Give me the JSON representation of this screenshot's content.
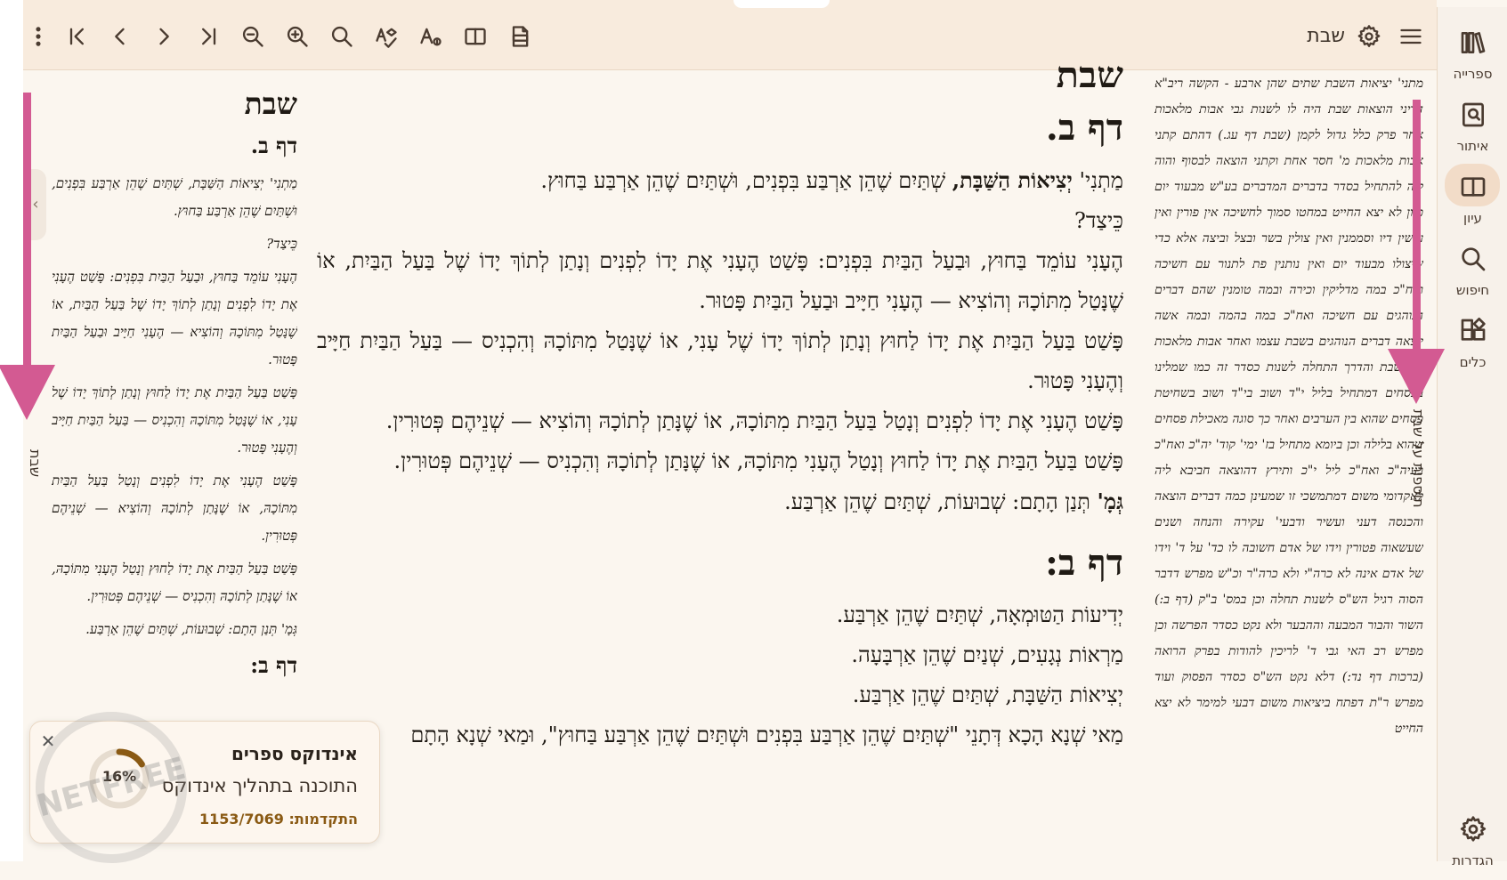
{
  "book_title": "שבת",
  "toolbar": {
    "buttons": [
      "more",
      "first-page",
      "previous",
      "next",
      "last-page",
      "zoom-out",
      "zoom-in",
      "search",
      "spell",
      "font",
      "columns",
      "pdf"
    ]
  },
  "right_nav": {
    "items": [
      {
        "icon": "library-icon",
        "label": "ספרייה"
      },
      {
        "icon": "locate-icon",
        "label": "איתור"
      },
      {
        "icon": "reading-icon",
        "label": "עיון"
      },
      {
        "icon": "search-icon",
        "label": "חיפוש"
      },
      {
        "icon": "tools-icon",
        "label": "כלים"
      }
    ],
    "settings": {
      "icon": "gear-icon",
      "label": "הגדרות"
    }
  },
  "main": {
    "title": "שבת",
    "daf1": "דף ב.",
    "mishnah_prefix": "מַתְנִי'",
    "mishnah_bold": "יְצִיאוֹת הַשַּׁבָּת,",
    "mishnah_rest": "שְׁתַּיִם שֶׁהֵן אַרְבַּע בִּפְנִים, וּשְׁתַּיִם שֶׁהֵן אַרְבַּע בַּחוּץ.",
    "p2": "כֵּיצַד?",
    "p3": "הֶעָנִי עוֹמֵד בַּחוּץ, וּבַעַל הַבַּיִת בִּפְנִים: פָּשַׁט הֶעָנִי אֶת יָדוֹ לִפְנִים וְנָתַן לְתוֹךְ יָדוֹ שֶׁל בַּעַל הַבַּיִת, אוֹ שֶׁנָּטַל מִתּוֹכָהּ וְהוֹצִיא — הֶעָנִי חַיָּיב וּבַעַל הַבַּיִת פָּטוּר.",
    "p4": "פָּשַׁט בַּעַל הַבַּיִת אֶת יָדוֹ לַחוּץ וְנָתַן לְתוֹךְ יָדוֹ שֶׁל עָנִי, אוֹ שֶׁנָּטַל מִתּוֹכָהּ וְהִכְנִיס — בַּעַל הַבַּיִת חַיָּיב וְהֶעָנִי פָּטוּר.",
    "p5": "פָּשַׁט הֶעָנִי אֶת יָדוֹ לִפְנִים וְנָטַל בַּעַל הַבַּיִת מִתּוֹכָהּ, אוֹ שֶׁנָּתַן לְתוֹכָהּ וְהוֹצִיא — שְׁנֵיהֶם פְּטוּרִין.",
    "p6": "פָּשַׁט בַּעַל הַבַּיִת אֶת יָדוֹ לַחוּץ וְנָטַל הֶעָנִי מִתּוֹכָהּ, אוֹ שֶׁנָּתַן לְתוֹכָהּ וְהִכְנִיס — שְׁנֵיהֶם פְּטוּרִין.",
    "gemara_bold": "גְּמָ'",
    "gemara_rest": "תְּנַן הָתָם: שְׁבוּעוֹת, שְׁתַּיִם שֶׁהֵן אַרְבַּע.",
    "daf2": "דף ב:",
    "l1": "יְדִיעוֹת הַטּוּמְאָה, שְׁתַּיִם שֶׁהֵן אַרְבַּע.",
    "l2": "מַרְאוֹת נְגָעִים, שְׁנַיִם שֶׁהֵן אַרְבָּעָה.",
    "l3": "יְצִיאוֹת הַשַּׁבָּת, שְׁתַּיִם שֶׁהֵן אַרְבַּע.",
    "l4": "מַאי שְׁנָא הָכָא דְּתָנֵי \"שְׁתַּיִם שֶׁהֵן אַרְבַּע בִּפְנִים וּשְׁתַּיִם שֶׁהֵן אַרְבַּע בַּחוּץ\", וּמַאי שְׁנָא הָתָם"
  },
  "left_commentary": {
    "vertical_label": "שבת",
    "title": "שבת",
    "daf1": "דף ב.",
    "p1": "מַתְנִי' יְצִיאוֹת הַשַּׁבָּת, שְׁתַּיִם שֶׁהֵן אַרְבַּע בִּפְנִים, וּשְׁתַּיִם שֶׁהֵן אַרְבַּע בַּחוּץ.",
    "p2": "כֵּיצַד?",
    "p3": "הֶעָנִי עוֹמֵד בַּחוּץ, וּבַעַל הַבַּיִת בִּפְנִים: פָּשַׁט הֶעָנִי אֶת יָדוֹ לִפְנִים וְנָתַן לְתוֹךְ יָדוֹ שֶׁל בַּעַל הַבַּיִת, אוֹ שֶׁנָּטַל מִתּוֹכָהּ וְהוֹצִיא — הֶעָנִי חַיָּיב וּבַעַל הַבַּיִת פָּטוּר.",
    "p4": "פָּשַׁט בַּעַל הַבַּיִת אֶת יָדוֹ לַחוּץ וְנָתַן לְתוֹךְ יָדוֹ שֶׁל עָנִי, אוֹ שֶׁנָּטַל מִתּוֹכָהּ וְהִכְנִיס — בַּעַל הַבַּיִת חַיָּיב וְהֶעָנִי פָּטוּר.",
    "p5": "פָּשַׁט הֶעָנִי אֶת יָדוֹ לִפְנִים וְנָטַל בַּעַל הַבַּיִת מִתּוֹכָהּ, אוֹ שֶׁנָּתַן לְתוֹכָהּ וְהוֹצִיא — שְׁנֵיהֶם פְּטוּרִין.",
    "p6": "פָּשַׁט בַּעַל הַבַּיִת אֶת יָדוֹ לַחוּץ וְנָטַל הֶעָנִי מִתּוֹכָהּ, אוֹ שֶׁנָּתַן לְתוֹכָהּ וְהִכְנִיס — שְׁנֵיהֶם פְּטוּרִין.",
    "p7": "גְּמָ' תְּנַן הָתָם: שְׁבוּעוֹת, שְׁתַּיִם שֶׁהֵן אַרְבַּע.",
    "daf2": "דף ב:"
  },
  "right_commentary": {
    "vertical_label": "תוספות על שבת",
    "text": "מתני' יציאות השבת שתים שהן ארבע - הקשה ריב\"א דדיני הוצאות שבת היה לו לשנות גבי אבות מלאכות אחר פרק כלל גדול לקמן (שבת דף עג.) דהתם קתני אבות מלאכות מ' חסר אחת וקתני הוצאה לבסוף והוה ליה להתחיל בסדר בדברים המדברים בע\"ש מבעוד יום כגון לא יצא החייט במחטו סמוך לחשיכה אין פורין ואין עושין דיו וסממנין ואין צולין בשר ובצל וביצה אלא כדי שיצולו מבעוד יום ואין נותנין פת לתנור עם חשיכה ואח\"כ במה מדליקין וכירה ובמה טומנין שהם דברים הנוהגים עם חשיכה ואח\"כ במה בהמה ובמה אשה יוצאה דברים הנוהגים בשבת עצמו ואחר אבות מלאכות של שבת והדרך התחלה לשנות כסדר זה כמו שמלינו בפסחים דמתחיל בליל י\"ד ושוב בי\"ד ושוב בשחיטת פסחים שהוא בין הערבים ואחר כך סוגה מאכילת פסחים שהוא בלילה וכן ביומא מתחיל בז' ימי' קוד' יה\"כ ואח\"כ בעיה\"כ ואח\"כ ליל י\"כ ותירץ דהוצאה חביבא ליה לאקדומי משום דמתמשכי זו שמעינן כמה דברים הוצאה והכנסה דעני ועשיר ודבעי' עקירה והנחה ושנים שעשאוה פטורין וידו של אדם חשובה לו כד' על ד' וידו של אדם אינה לא כרה\"י ולא כרה\"ר וכ\"ש מפרש דדבר הסוה רגיל הש\"ס לשנות תחלה וכן במס' ב\"ק (דף ב:) השור והבור המבעה וההבער ולא נקט כסדר הפרשה וכן מפרש רב האי גבי ד' לריכין להודות בפרק הרואה (ברכות דף נד:) דלא נקט הש\"ס כסדר הפסוק ועוד מפרש ר\"ת דפתח ביציאות משום דבעי למימר לא יצא החייט"
  },
  "toast": {
    "title": "אינדוקס ספרים",
    "message": "התוכנה בתהליך אינדוקס",
    "progress_label": "התקדמות: 1153/7069",
    "percent_text": "16%",
    "percent": 0.16,
    "watermark": "NETFREE"
  },
  "colors": {
    "accent_pink": "#d35a92",
    "ring_progress": "#8a5a14",
    "topbar_bg": "#f8ebdd"
  }
}
